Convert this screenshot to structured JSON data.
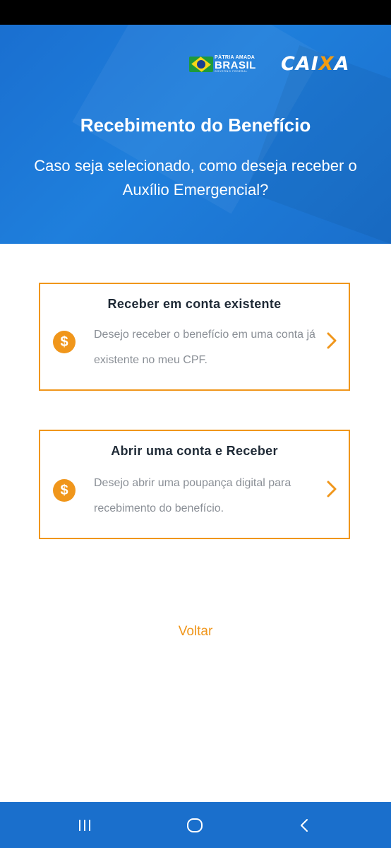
{
  "brand": {
    "gov_line1": "PÁTRIA AMADA",
    "gov_line2": "BRASIL",
    "gov_line3": "GOVERNO FEDERAL",
    "caixa_pre": "CAI",
    "caixa_x": "X",
    "caixa_post": "A"
  },
  "header": {
    "title": "Recebimento do Benefício",
    "subtitle": "Caso seja selecionado, como deseja receber o Auxílio Emergencial?"
  },
  "options": [
    {
      "title": "Receber em conta existente",
      "description": "Desejo receber o benefício em uma conta já existente no meu CPF.",
      "icon": "dollar-coin-icon"
    },
    {
      "title": "Abrir uma conta e Receber",
      "description": "Desejo abrir uma poupança digital para recebimento do benefício.",
      "icon": "dollar-coin-icon"
    }
  ],
  "coin_symbol": "$",
  "back_label": "Voltar",
  "colors": {
    "accent": "#f0961b",
    "header_blue": "#1f7fdc",
    "nav_blue": "#1a6fcc",
    "title_text": "#1f2a36",
    "desc_text": "#8a8f96"
  },
  "nav": [
    "recent-apps-icon",
    "home-icon",
    "back-icon"
  ]
}
